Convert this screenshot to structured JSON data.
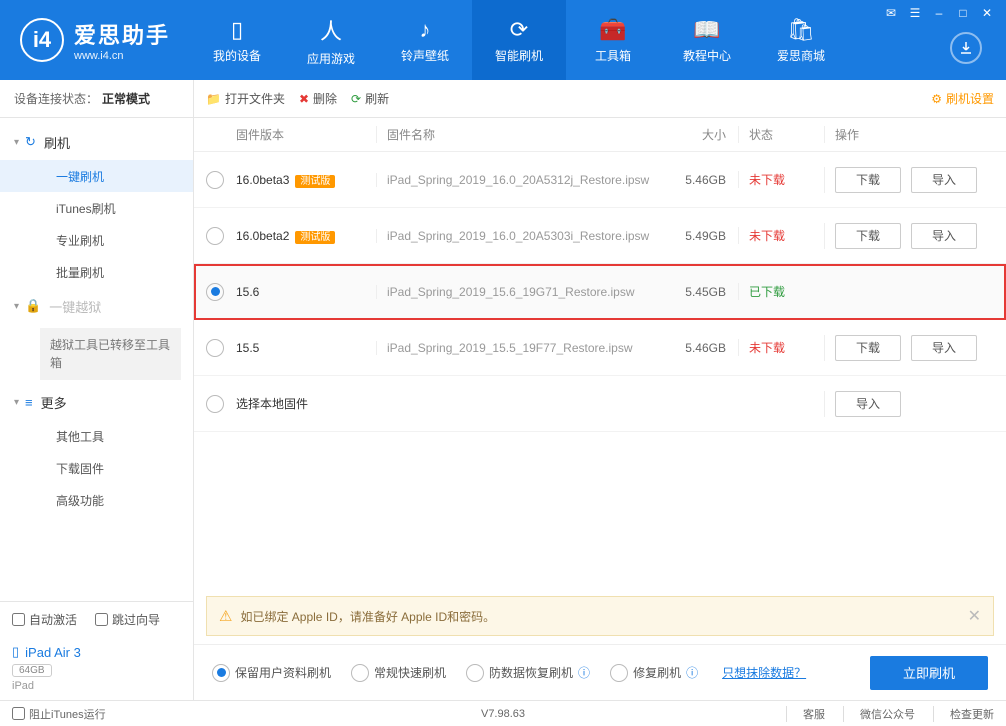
{
  "app": {
    "title": "爱思助手",
    "url": "www.i4.cn"
  },
  "nav": [
    {
      "label": "我的设备"
    },
    {
      "label": "应用游戏"
    },
    {
      "label": "铃声壁纸"
    },
    {
      "label": "智能刷机"
    },
    {
      "label": "工具箱"
    },
    {
      "label": "教程中心"
    },
    {
      "label": "爱思商城"
    }
  ],
  "conn": {
    "label": "设备连接状态：",
    "mode": "正常模式"
  },
  "sidebar": {
    "cat_flash": "刷机",
    "items_flash": [
      "一键刷机",
      "iTunes刷机",
      "专业刷机",
      "批量刷机"
    ],
    "cat_jb": "一键越狱",
    "jb_note": "越狱工具已转移至工具箱",
    "cat_more": "更多",
    "items_more": [
      "其他工具",
      "下载固件",
      "高级功能"
    ]
  },
  "bottom": {
    "auto_activate": "自动激活",
    "skip_guide": "跳过向导",
    "device_name": "iPad Air 3",
    "capacity": "64GB",
    "device_sub": "iPad"
  },
  "toolbar": {
    "open": "打开文件夹",
    "delete": "删除",
    "refresh": "刷新",
    "settings": "刷机设置"
  },
  "thead": {
    "ver": "固件版本",
    "name": "固件名称",
    "size": "大小",
    "state": "状态",
    "act": "操作"
  },
  "rows": [
    {
      "ver": "16.0beta3",
      "beta": "测试版",
      "name": "iPad_Spring_2019_16.0_20A5312j_Restore.ipsw",
      "size": "5.46GB",
      "state": "未下载",
      "state_cls": "un",
      "selected": false,
      "dl": "下载",
      "imp": "导入"
    },
    {
      "ver": "16.0beta2",
      "beta": "测试版",
      "name": "iPad_Spring_2019_16.0_20A5303i_Restore.ipsw",
      "size": "5.49GB",
      "state": "未下载",
      "state_cls": "un",
      "selected": false,
      "dl": "下载",
      "imp": "导入"
    },
    {
      "ver": "15.6",
      "beta": null,
      "name": "iPad_Spring_2019_15.6_19G71_Restore.ipsw",
      "size": "5.45GB",
      "state": "已下载",
      "state_cls": "dn",
      "selected": true,
      "highlight": true
    },
    {
      "ver": "15.5",
      "beta": null,
      "name": "iPad_Spring_2019_15.5_19F77_Restore.ipsw",
      "size": "5.46GB",
      "state": "未下载",
      "state_cls": "un",
      "selected": false,
      "dl": "下载",
      "imp": "导入"
    },
    {
      "ver": "选择本地固件",
      "beta": null,
      "name": "",
      "size": "",
      "state": "",
      "selected": false,
      "imp": "导入"
    }
  ],
  "notice": "如已绑定 Apple ID，请准备好 Apple ID和密码。",
  "flash_opts": {
    "keep": "保留用户资料刷机",
    "fast": "常规快速刷机",
    "anti": "防数据恢复刷机",
    "repair": "修复刷机",
    "erase_q": "只想抹除数据？",
    "go": "立即刷机"
  },
  "footer": {
    "block": "阻止iTunes运行",
    "ver": "V7.98.63",
    "svc": "客服",
    "wx": "微信公众号",
    "upd": "检查更新"
  }
}
